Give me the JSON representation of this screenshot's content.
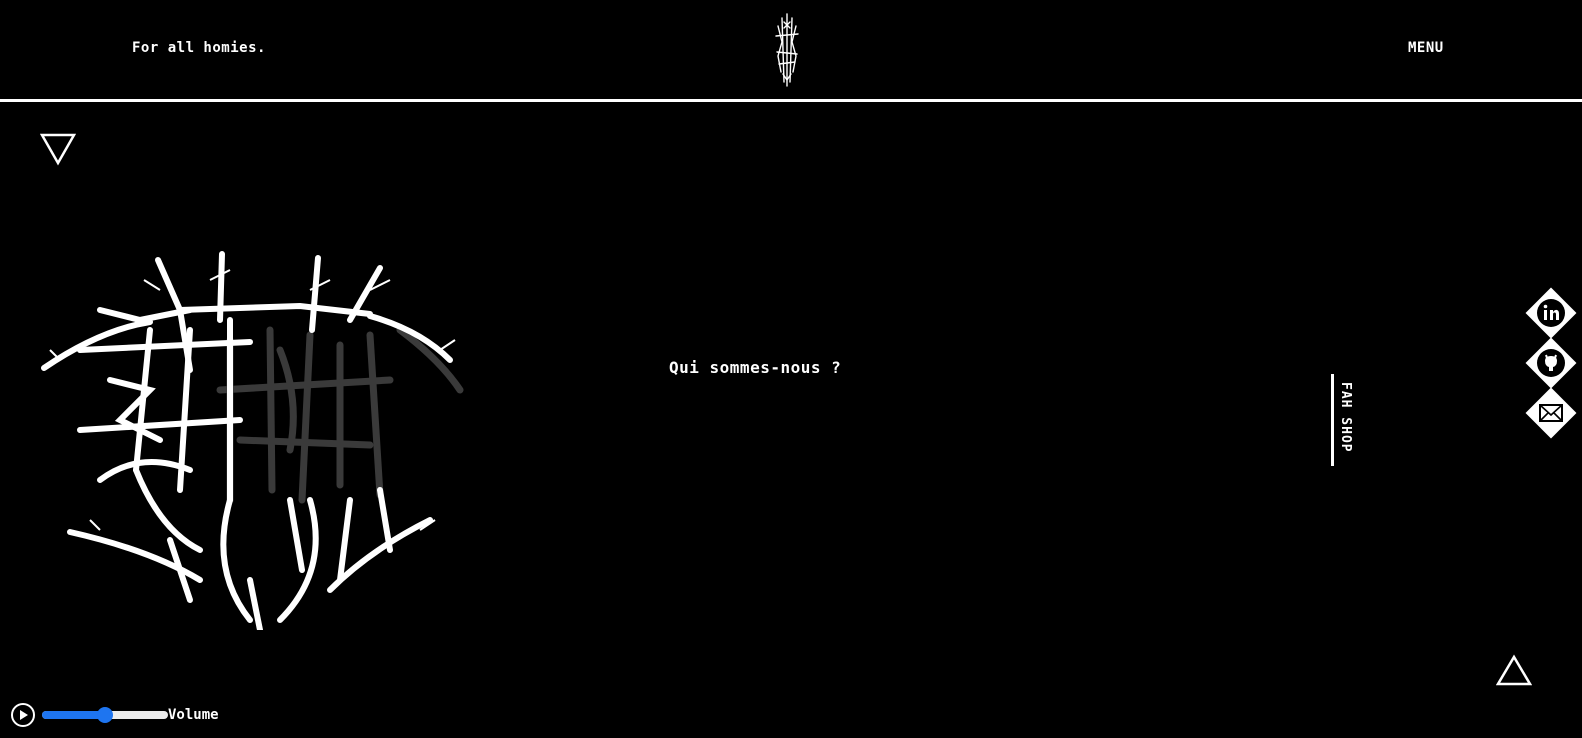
{
  "header": {
    "tagline": "For all homies.",
    "menu_label": "MENU"
  },
  "main": {
    "about_title": "Qui sommes-nous ?"
  },
  "shop": {
    "label": "FAH SHOP"
  },
  "social": [
    {
      "name": "linkedin",
      "icon": "linkedin-icon"
    },
    {
      "name": "github",
      "icon": "github-icon"
    },
    {
      "name": "email",
      "icon": "mail-icon"
    }
  ],
  "player": {
    "volume_label": "Volume",
    "volume_level": 0.5,
    "accent_color": "#1e75f0"
  },
  "colors": {
    "background": "#000000",
    "foreground": "#ffffff",
    "logo_shadow": "#3a3a3a"
  }
}
